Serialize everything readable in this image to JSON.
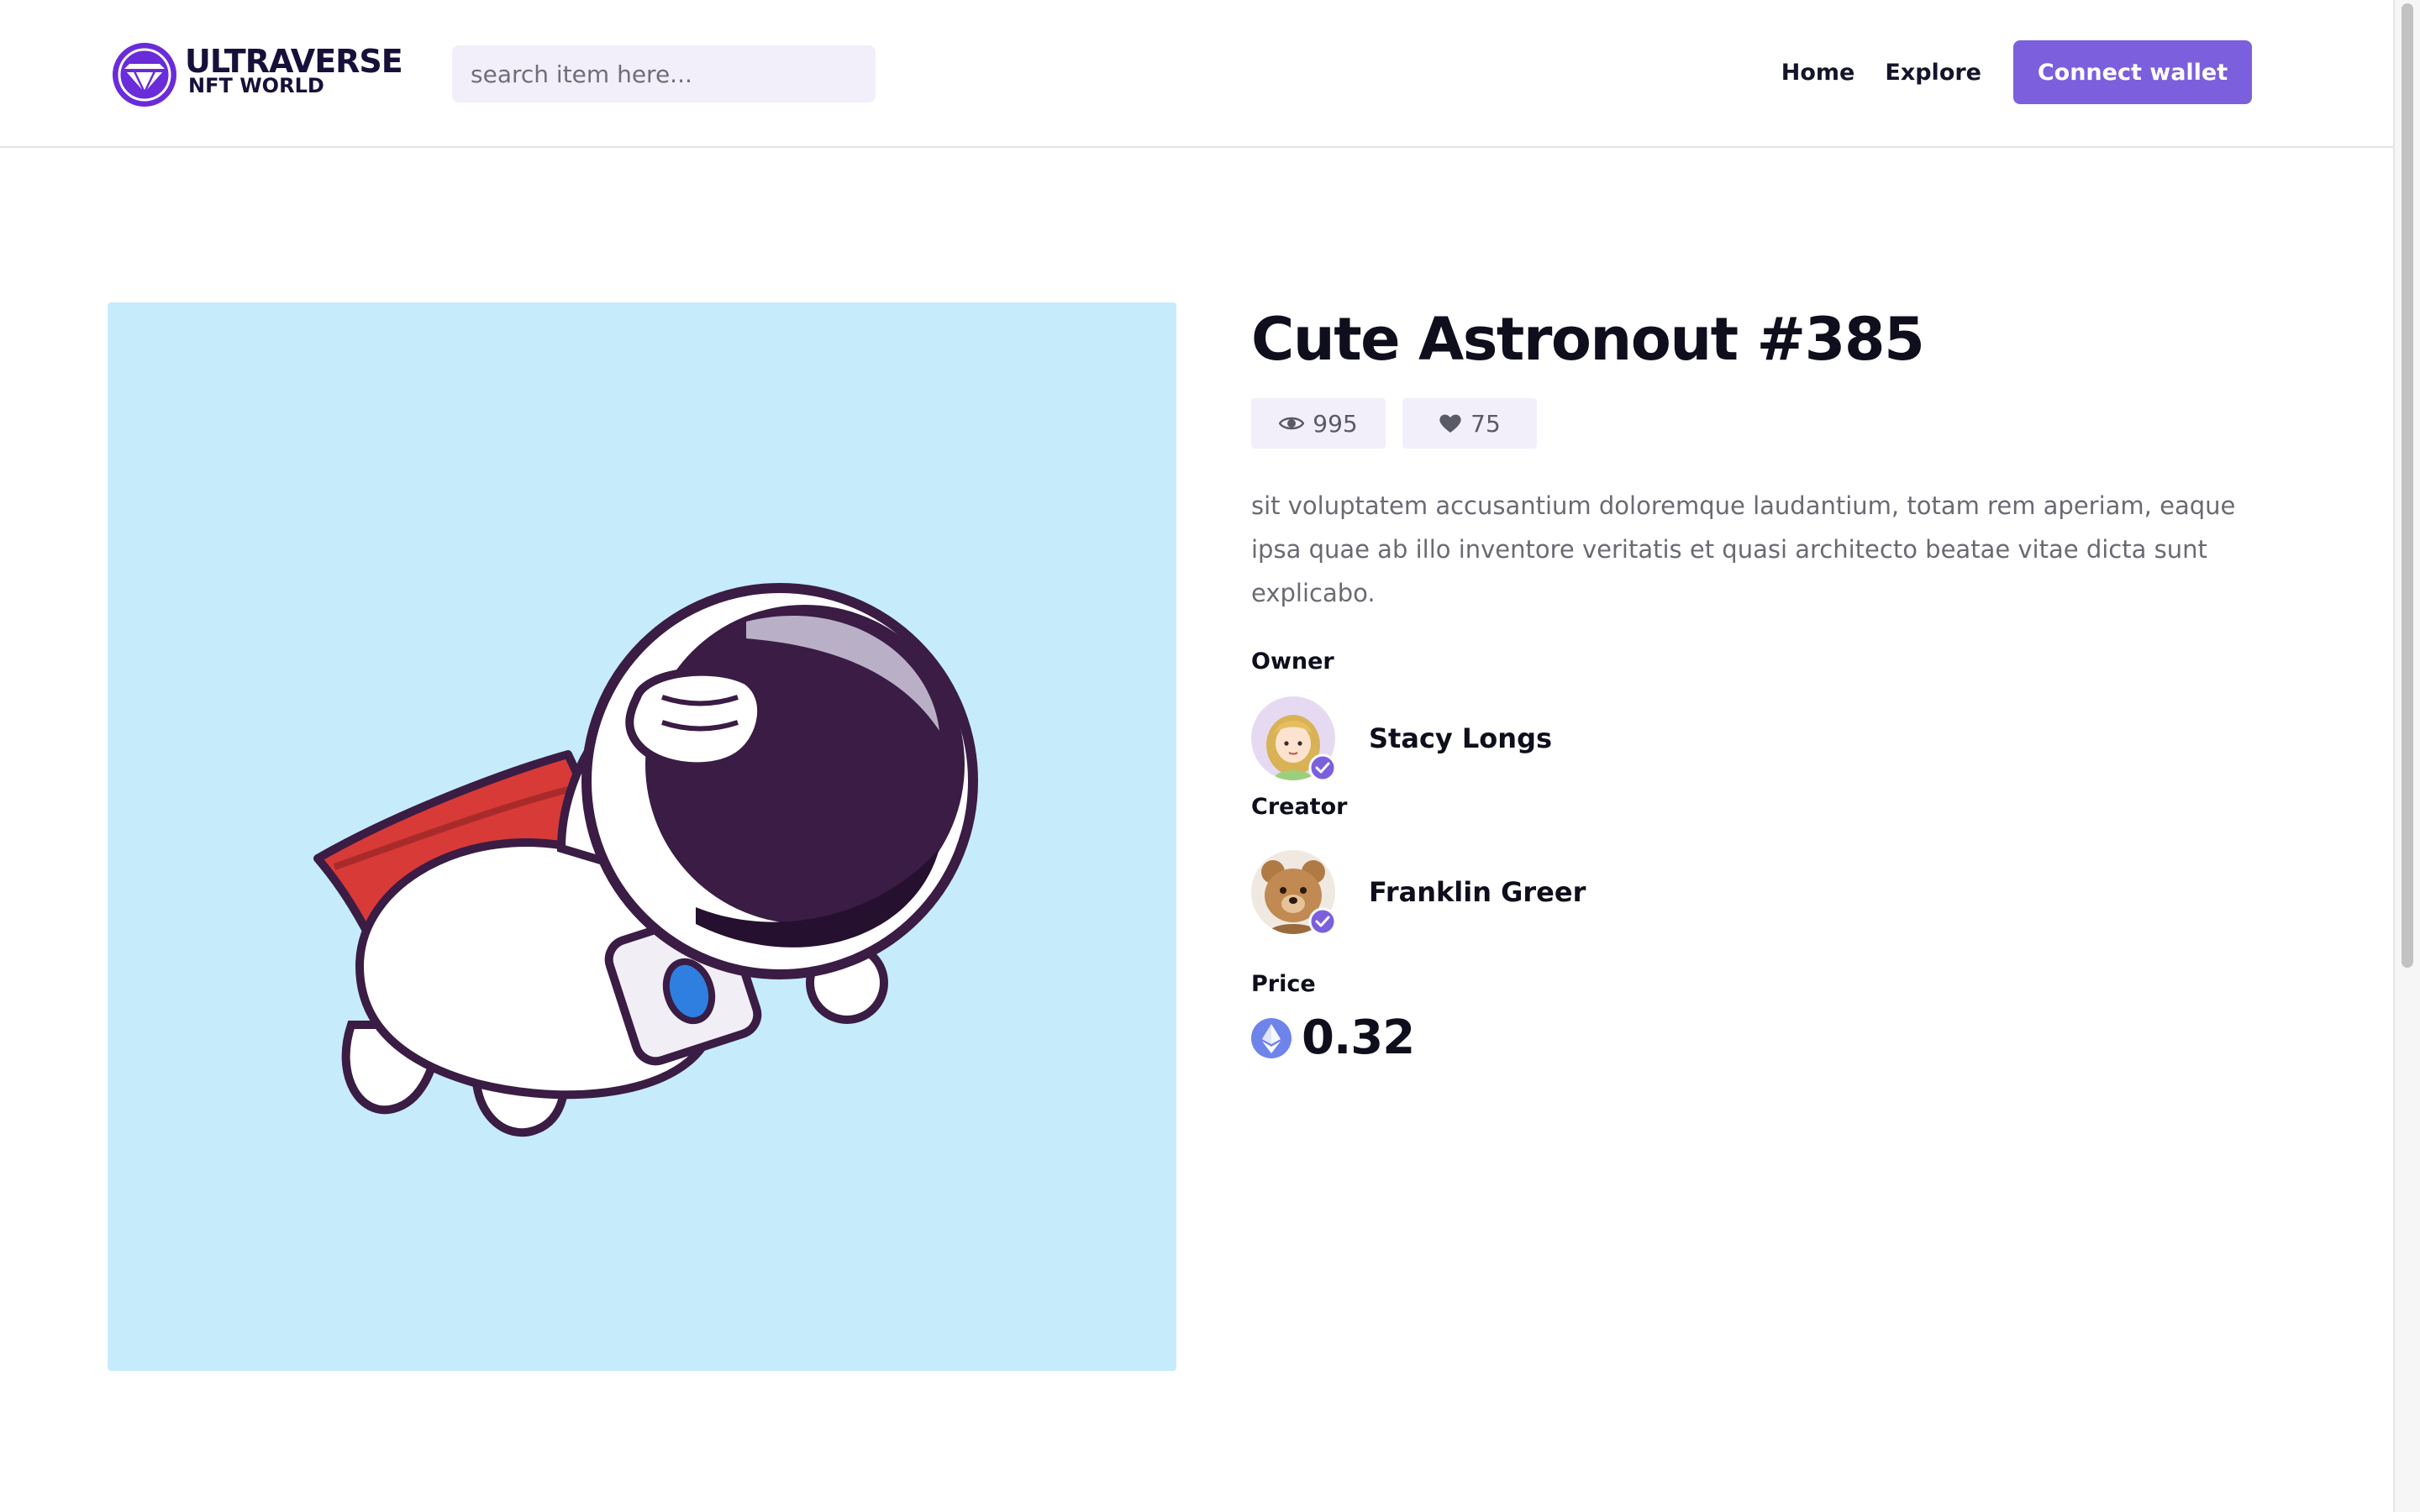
{
  "brand": {
    "name": "ULTRAVERSE",
    "subtitle": "NFT WORLD",
    "logo_icon": "diamond-icon"
  },
  "search": {
    "placeholder": "search item here..."
  },
  "nav": {
    "home": "Home",
    "explore": "Explore",
    "connect": "Connect wallet"
  },
  "item": {
    "title": "Cute Astronout #385",
    "views": "995",
    "likes": "75",
    "description": "sit voluptatem accusantium doloremque laudantium, totam rem aperiam, eaque ipsa quae ab illo inventore veritatis et quasi architecto beatae vitae dicta sunt explicabo.",
    "owner_label": "Owner",
    "owner_name": "Stacy Longs",
    "creator_label": "Creator",
    "creator_name": "Franklin Greer",
    "price_label": "Price",
    "price": "0.32",
    "currency_icon": "ethereum-icon"
  },
  "colors": {
    "accent": "#7b5fdc",
    "chip_bg": "#f2effa",
    "art_bg": "#c6ecfb",
    "text_dark": "#0e0e1c",
    "text_muted": "#6a6a74"
  }
}
